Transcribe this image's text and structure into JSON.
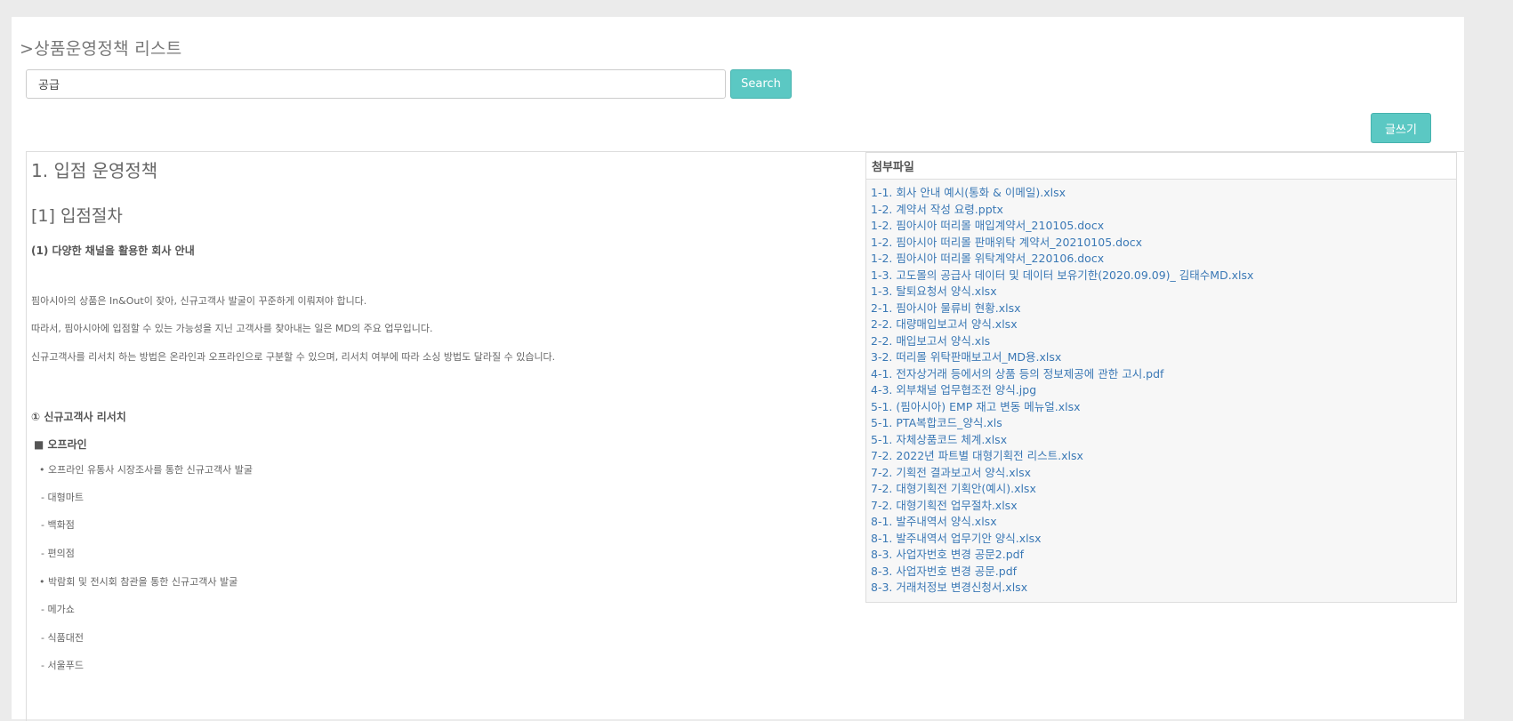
{
  "page": {
    "title": ">상품운영정책 리스트"
  },
  "search": {
    "value": "공급",
    "button_label": "Search"
  },
  "write_button_label": "글쓰기",
  "content": {
    "section_title": "1. 입점 운영정책",
    "subsection_title": "[1] 입점절차",
    "item_heading": "(1) 다양한 채널을 활용한 회사 안내",
    "paragraphs": [
      "핌아시아의 상품은 In&Out이 잦아, 신규고객사 발굴이 꾸준하게 이뤄져야 합니다.",
      "따라서, 핌아시아에 입점할 수 있는 가능성을 지닌 고객사를 찾아내는 일은 MD의 주요 업무입니다.",
      "신규고객사를 리서치 하는 방법은 온라인과 오프라인으로 구분할 수 있으며, 리서치 여부에 따라 소싱 방법도 달라질 수 있습니다."
    ],
    "research_heading": "① 신규고객사 리서치",
    "offline_heading": "■ 오프라인",
    "bullet1": "• 오프라인 유통사 시장조사를 통한 신규고객사 발굴",
    "bullet1_items": [
      "- 대형마트",
      "- 백화점",
      "- 편의점"
    ],
    "bullet2": "• 박람회 및 전시회 참관을 통한 신규고객사 발굴",
    "bullet2_items": [
      "- 메가쇼",
      "- 식품대전",
      "- 서울푸드"
    ]
  },
  "attachments": {
    "header": "첨부파일",
    "files": [
      "1-1. 회사 안내 예시(통화 & 이메일).xlsx",
      "1-2. 계약서 작성 요령.pptx",
      "1-2. 핌아시아 떠리몰 매입계약서_210105.docx",
      "1-2. 핌아시아 떠리몰 판매위탁 계약서_20210105.docx",
      "1-2. 핌아시아 떠리몰 위탁계약서_220106.docx",
      "1-3. 고도몰의 공급사 데이터 및 데이터 보유기한(2020.09.09)_ 김태수MD.xlsx",
      "1-3. 탈퇴요청서 양식.xlsx",
      "2-1. 핌아시아 물류비 현황.xlsx",
      "2-2. 대량매입보고서 양식.xlsx",
      "2-2. 매입보고서 양식.xls",
      "3-2. 떠리몰 위탁판매보고서_MD용.xlsx",
      "4-1. 전자상거래 등에서의 상품 등의 정보제공에 관한 고시.pdf",
      "4-3. 외부채널 업무협조전 양식.jpg",
      "5-1. (핌아시아) EMP 재고 변동 메뉴얼.xlsx",
      "5-1. PTA복합코드_양식.xls",
      "5-1. 자체상품코드 체계.xlsx",
      "7-2. 2022년 파트별 대형기획전 리스트.xlsx",
      "7-2. 기획전 결과보고서 양식.xlsx",
      "7-2. 대형기획전 기획안(예시).xlsx",
      "7-2. 대형기획전 업무절차.xlsx",
      "8-1. 발주내역서 양식.xlsx",
      "8-1. 발주내역서 업무기안 양식.xlsx",
      "8-3. 사업자번호 변경 공문2.pdf",
      "8-3. 사업자번호 변경 공문.pdf",
      "8-3. 거래처정보 변경신청서.xlsx"
    ]
  },
  "colors": {
    "accent": "#5bc8c3",
    "link": "#3a78b5",
    "background": "#ebebeb"
  }
}
